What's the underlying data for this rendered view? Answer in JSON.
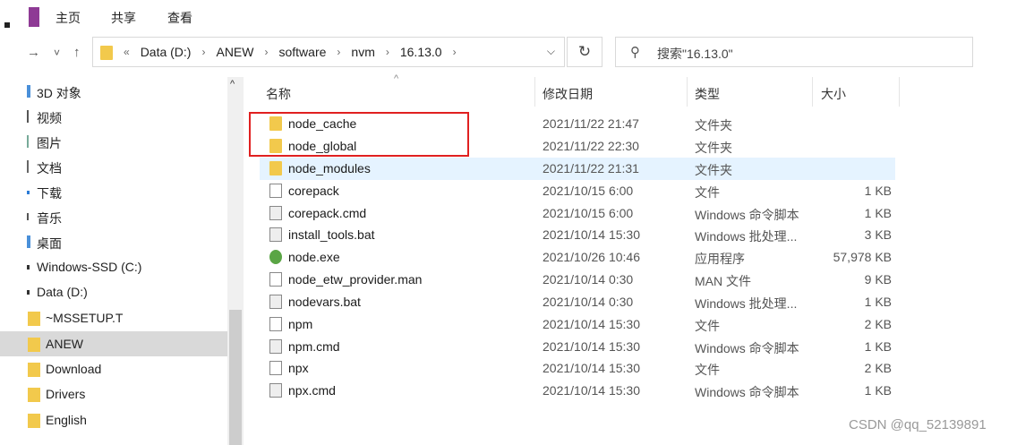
{
  "ribbon": {
    "tabs": [
      "主页",
      "共享",
      "查看"
    ]
  },
  "nav": {
    "back": "→",
    "recent": "˅",
    "up": "↑"
  },
  "address": {
    "overflow": "«",
    "crumbs": [
      "Data (D:)",
      "ANEW",
      "software",
      "nvm",
      "16.13.0"
    ],
    "sep": "›",
    "dropdown": "⌵"
  },
  "refresh": "↻",
  "search": {
    "icon": "search-icon",
    "placeholder": "搜索\"16.13.0\""
  },
  "sidebar": {
    "scroll_up": "^",
    "items": [
      {
        "label": "3D 对象"
      },
      {
        "label": "视频"
      },
      {
        "label": "图片"
      },
      {
        "label": "文档"
      },
      {
        "label": "下载"
      },
      {
        "label": "音乐"
      },
      {
        "label": "桌面"
      },
      {
        "label": "Windows-SSD (C:)"
      },
      {
        "label": "Data (D:)"
      },
      {
        "label": "~MSSETUP.T"
      },
      {
        "label": "ANEW"
      },
      {
        "label": "Download"
      },
      {
        "label": "Drivers"
      },
      {
        "label": "English"
      }
    ]
  },
  "columns": {
    "name": "名称",
    "date": "修改日期",
    "type": "类型",
    "size": "大小",
    "sort": "^"
  },
  "files": [
    {
      "name": "node_cache",
      "date": "2021/11/22 21:47",
      "type": "文件夹",
      "size": "",
      "icon": "folder-icon"
    },
    {
      "name": "node_global",
      "date": "2021/11/22 22:30",
      "type": "文件夹",
      "size": "",
      "icon": "folder-icon"
    },
    {
      "name": "node_modules",
      "date": "2021/11/22 21:31",
      "type": "文件夹",
      "size": "",
      "icon": "folder-icon"
    },
    {
      "name": "corepack",
      "date": "2021/10/15 6:00",
      "type": "文件",
      "size": "1 KB",
      "icon": "file-icon"
    },
    {
      "name": "corepack.cmd",
      "date": "2021/10/15 6:00",
      "type": "Windows 命令脚本",
      "size": "1 KB",
      "icon": "cmd-icon"
    },
    {
      "name": "install_tools.bat",
      "date": "2021/10/14 15:30",
      "type": "Windows 批处理...",
      "size": "3 KB",
      "icon": "bat-icon"
    },
    {
      "name": "node.exe",
      "date": "2021/10/26 10:46",
      "type": "应用程序",
      "size": "57,978 KB",
      "icon": "nodejs-icon"
    },
    {
      "name": "node_etw_provider.man",
      "date": "2021/10/14 0:30",
      "type": "MAN 文件",
      "size": "9 KB",
      "icon": "file-icon"
    },
    {
      "name": "nodevars.bat",
      "date": "2021/10/14 0:30",
      "type": "Windows 批处理...",
      "size": "1 KB",
      "icon": "bat-icon"
    },
    {
      "name": "npm",
      "date": "2021/10/14 15:30",
      "type": "文件",
      "size": "2 KB",
      "icon": "file-icon"
    },
    {
      "name": "npm.cmd",
      "date": "2021/10/14 15:30",
      "type": "Windows 命令脚本",
      "size": "1 KB",
      "icon": "cmd-icon"
    },
    {
      "name": "npx",
      "date": "2021/10/14 15:30",
      "type": "文件",
      "size": "2 KB",
      "icon": "file-icon"
    },
    {
      "name": "npx.cmd",
      "date": "2021/10/14 15:30",
      "type": "Windows 命令脚本",
      "size": "1 KB",
      "icon": "cmd-icon"
    }
  ],
  "watermark": "CSDN @qq_52139891",
  "colors": {
    "highlight_box": "#e02020",
    "row_hover": "#e5f3ff",
    "folder": "#f2c94c"
  }
}
